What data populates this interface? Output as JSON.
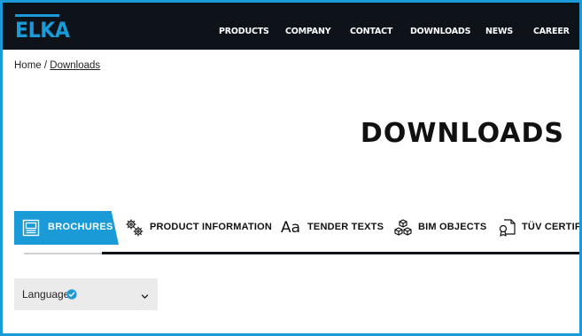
{
  "header": {
    "logo_text": "ELKA",
    "nav": [
      "PRODUCTS",
      "COMPANY",
      "CONTACT",
      "DOWNLOADS",
      "NEWS",
      "CAREER"
    ]
  },
  "breadcrumb": {
    "home": "Home",
    "separator": " / ",
    "current": "Downloads"
  },
  "page_title": "DOWNLOADS",
  "tabs": [
    {
      "label": "BROCHURES",
      "icon": "brochure-icon",
      "active": true
    },
    {
      "label": "PRODUCT INFORMATION",
      "icon": "gears-icon",
      "active": false
    },
    {
      "label": "TENDER TEXTS",
      "icon": "typography-icon",
      "active": false
    },
    {
      "label": "BIM OBJECTS",
      "icon": "cubes-icon",
      "active": false
    },
    {
      "label": "TÜV CERTIFI",
      "icon": "certificate-icon",
      "active": false
    }
  ],
  "filter": {
    "label": "Language",
    "icon": "check-badge-icon",
    "dropdown_icon": "chevron-down-icon"
  },
  "colors": {
    "accent": "#1a9ad6",
    "header_bg": "#0d1319",
    "filter_bg": "#ebebeb"
  }
}
